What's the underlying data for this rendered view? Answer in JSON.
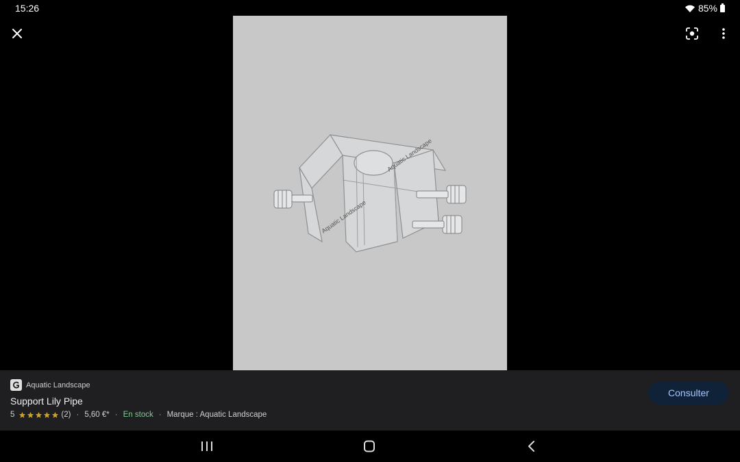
{
  "status_bar": {
    "time": "15:26",
    "battery": "85%"
  },
  "info_panel": {
    "source": "Aquatic Landscape",
    "title": "Support Lily Pipe",
    "rating": "5",
    "rating_stars": 5,
    "review_count": "(2)",
    "price": "5,60 €*",
    "separator": "·",
    "stock": "En stock",
    "brand": "Marque : Aquatic Landscape",
    "consult_label": "Consulter"
  },
  "image": {
    "watermark": "Aquatic Landscape"
  },
  "colors": {
    "background": "#000000",
    "panel": "#1f1f21",
    "image_backdrop": "#c8c8c8",
    "stock_green": "#81c995",
    "button_bg": "#0f2238",
    "button_text": "#a8c7fa",
    "star": "#c9a227"
  },
  "icons": {
    "close": "close-icon",
    "lens": "lens-icon",
    "more": "more-vert-icon",
    "wifi": "wifi-icon",
    "battery": "battery-icon",
    "nav_recent": "recent-apps-icon",
    "nav_home": "home-icon",
    "nav_back": "back-icon"
  }
}
